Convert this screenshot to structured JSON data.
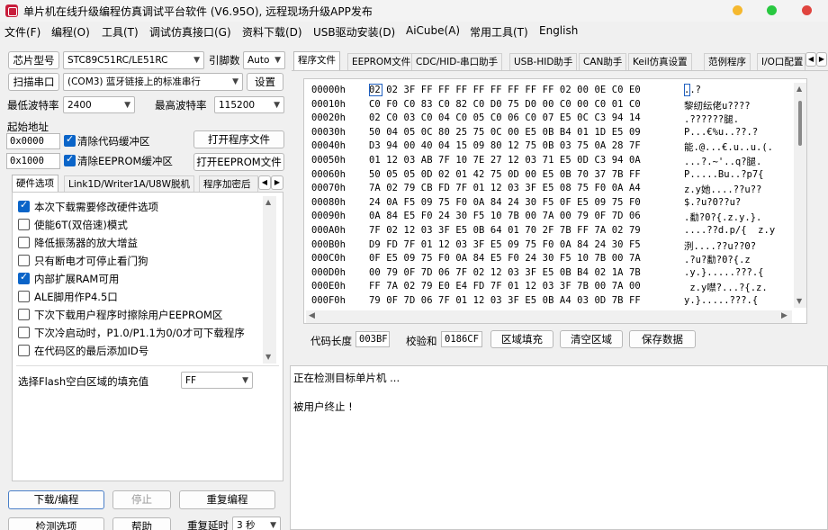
{
  "window": {
    "title": "单片机在线升级编程仿真调试平台软件 (V6.95O), 远程现场升级APP发布",
    "colors": {
      "min": "#f5b82e",
      "max": "#28c840",
      "close": "#e0443e",
      "brand": "#c81e3c"
    }
  },
  "menu": [
    "文件(F)",
    "编程(O)",
    "工具(T)",
    "调试仿真接口(G)",
    "资料下载(D)",
    "USB驱动安装(D)",
    "AiCube(A)",
    "常用工具(T)",
    "English"
  ],
  "left": {
    "chip_type_button": "芯片型号",
    "chip_type_value": "STC89C51RC/LE51RC",
    "pin_count_label": "引脚数",
    "pin_count_value": "Auto",
    "scan_port_button": "扫描串口",
    "port_value": "(COM3) 蓝牙链接上的标准串行",
    "settings_button": "设置",
    "min_baud_label": "最低波特率",
    "min_baud_value": "2400",
    "max_baud_label": "最高波特率",
    "max_baud_value": "115200",
    "start_addr_label": "起始地址",
    "addr1_value": "0x0000",
    "clear_code_label": "清除代码缓冲区",
    "open_program_button": "打开程序文件",
    "addr2_value": "0x1000",
    "clear_eeprom_label": "清除EEPROM缓冲区",
    "open_eeprom_button": "打开EEPROM文件",
    "tabs": [
      "硬件选项",
      "Link1D/Writer1A/U8W脱机",
      "程序加密后"
    ],
    "options": [
      {
        "label": "本次下载需要修改硬件选项",
        "checked": true
      },
      {
        "label": "使能6T(双倍速)模式",
        "checked": false
      },
      {
        "label": "降低振荡器的放大增益",
        "checked": false
      },
      {
        "label": "只有断电才可停止看门狗",
        "checked": false
      },
      {
        "label": "内部扩展RAM可用",
        "checked": true
      },
      {
        "label": "ALE脚用作P4.5口",
        "checked": false
      },
      {
        "label": "下次下载用户程序时擦除用户EEPROM区",
        "checked": false
      },
      {
        "label": "下次冷启动时，P1.0/P1.1为0/0才可下载程序",
        "checked": false
      },
      {
        "label": "在代码区的最后添加ID号",
        "checked": false
      }
    ],
    "fill_label": "选择Flash空白区域的填充值",
    "fill_value": "FF",
    "download_button": "下载/编程",
    "stop_button": "停止",
    "reprogram_button": "重复编程",
    "detect_button": "检测选项",
    "help_button": "帮助",
    "repeat_delay_label": "重复延时",
    "repeat_delay_value": "3 秒"
  },
  "right": {
    "tabs": [
      "程序文件",
      "EEPROM文件",
      "CDC/HID-串口助手",
      "USB-HID助手",
      "CAN助手",
      "Keil仿真设置",
      "范例程序",
      "I/O口配置"
    ],
    "hex_rows": [
      {
        "addr": "00000h",
        "bytes": "02 02 3F FF FF FF FF FF FF FF FF 02 00 0E C0 E0",
        "ascii": "..?"
      },
      {
        "addr": "00010h",
        "bytes": "C0 F0 C0 83 C0 82 C0 D0 75 D0 00 C0 00 C0 01 C0",
        "ascii": "黎纫纭佬u????"
      },
      {
        "addr": "00020h",
        "bytes": "02 C0 03 C0 04 C0 05 C0 06 C0 07 E5 0C C3 94 14",
        "ascii": ".??????腿."
      },
      {
        "addr": "00030h",
        "bytes": "50 04 05 0C 80 25 75 0C 00 E5 0B B4 01 1D E5 09",
        "ascii": "P...€%u..??.?"
      },
      {
        "addr": "00040h",
        "bytes": "D3 94 00 40 04 15 09 80 12 75 0B 03 75 0A 28 7F",
        "ascii": "能.@...€.u..u.(."
      },
      {
        "addr": "00050h",
        "bytes": "01 12 03 AB 7F 10 7E 27 12 03 71 E5 0D C3 94 0A",
        "ascii": "...?.~'..q?腿."
      },
      {
        "addr": "00060h",
        "bytes": "50 05 05 0D 02 01 42 75 0D 00 E5 0B 70 37 7B FF",
        "ascii": "P.....Bu..?p7{"
      },
      {
        "addr": "00070h",
        "bytes": "7A 02 79 CB FD 7F 01 12 03 3F E5 08 75 F0 0A A4",
        "ascii": "z.y她....??u??"
      },
      {
        "addr": "00080h",
        "bytes": "24 0A F5 09 75 F0 0A 84 24 30 F5 0F E5 09 75 F0",
        "ascii": "$.?u?0??u?"
      },
      {
        "addr": "00090h",
        "bytes": "0A 84 E5 F0 24 30 F5 10 7B 00 7A 00 79 0F 7D 06",
        "ascii": ".勫?0?{.z.y.}."
      },
      {
        "addr": "000A0h",
        "bytes": "7F 02 12 03 3F E5 0B 64 01 70 2F 7B FF 7A 02 79",
        "ascii": "....??d.p/{  z.y"
      },
      {
        "addr": "000B0h",
        "bytes": "D9 FD 7F 01 12 03 3F E5 09 75 F0 0A 84 24 30 F5",
        "ascii": "洌....??u??0?"
      },
      {
        "addr": "000C0h",
        "bytes": "0F E5 09 75 F0 0A 84 E5 F0 24 30 F5 10 7B 00 7A",
        "ascii": ".?u?勫?0?{.z"
      },
      {
        "addr": "000D0h",
        "bytes": "00 79 0F 7D 06 7F 02 12 03 3F E5 0B B4 02 1A 7B",
        "ascii": ".y.}.....???.{"
      },
      {
        "addr": "000E0h",
        "bytes": "FF 7A 02 79 E0 E4 FD 7F 01 12 03 3F 7B 00 7A 00",
        "ascii": " z.y噤?...?{.z."
      },
      {
        "addr": "000F0h",
        "bytes": "79 0F 7D 06 7F 01 12 03 3F E5 0B A4 03 0D 7B FF",
        "ascii": "y.}.....???.{"
      }
    ],
    "code_length_label": "代码长度",
    "code_length_value": "003BF",
    "checksum_label": "校验和",
    "checksum_value": "0186CF",
    "fill_region_button": "区域填充",
    "clear_region_button": "清空区域",
    "save_data_button": "保存数据",
    "log": [
      "正在检测目标单片机 ...",
      "被用户终止 !"
    ]
  }
}
